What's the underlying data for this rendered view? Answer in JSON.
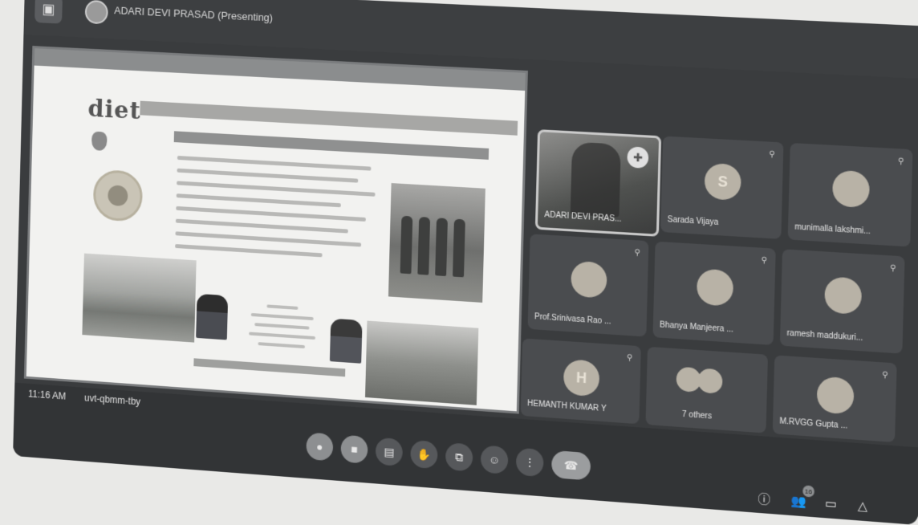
{
  "window": {
    "app_icon": "meet-icon",
    "presenter_title": "ADARI DEVI PRASAD (Presenting)"
  },
  "slide": {
    "logo_text": "diet"
  },
  "participants": [
    {
      "name": "ADARI DEVI PRAS...",
      "initial": "",
      "video": true,
      "icon": "pin-icon"
    },
    {
      "name": "Sarada Vijaya",
      "initial": "S",
      "video": false,
      "icon": "mic-off-icon"
    },
    {
      "name": "munimalla lakshmi...",
      "initial": "",
      "video": false,
      "icon": "mic-off-icon"
    },
    {
      "name": "Prof.Srinivasa Rao ...",
      "initial": "",
      "video": false,
      "icon": "mic-off-icon"
    },
    {
      "name": "Bhanya Manjeera ...",
      "initial": "",
      "video": false,
      "icon": "mic-off-icon"
    },
    {
      "name": "ramesh maddukuri...",
      "initial": "",
      "video": false,
      "icon": "mic-off-icon"
    },
    {
      "name": "HEMANTH KUMAR Y",
      "initial": "H",
      "video": false,
      "icon": "mic-off-icon"
    },
    {
      "name": "7 others",
      "initial": "",
      "video": false,
      "icon": ""
    },
    {
      "name": "M.RVGG Gupta ...",
      "initial": "",
      "video": false,
      "icon": "mic-off-icon"
    }
  ],
  "bottom_bar": {
    "time": "11:16 AM",
    "meeting_code": "uvt-qbmm-tby",
    "controls": [
      {
        "name": "mic-button",
        "icon": "mic-icon"
      },
      {
        "name": "camera-button",
        "icon": "camera-icon"
      },
      {
        "name": "captions-button",
        "icon": "captions-icon"
      },
      {
        "name": "raise-hand-button",
        "icon": "hand-icon"
      },
      {
        "name": "present-button",
        "icon": "present-icon"
      },
      {
        "name": "reactions-button",
        "icon": "emoji-icon"
      },
      {
        "name": "more-options-button",
        "icon": "more-icon"
      },
      {
        "name": "leave-call-button",
        "icon": "phone-icon"
      }
    ],
    "participant_count": "16"
  }
}
